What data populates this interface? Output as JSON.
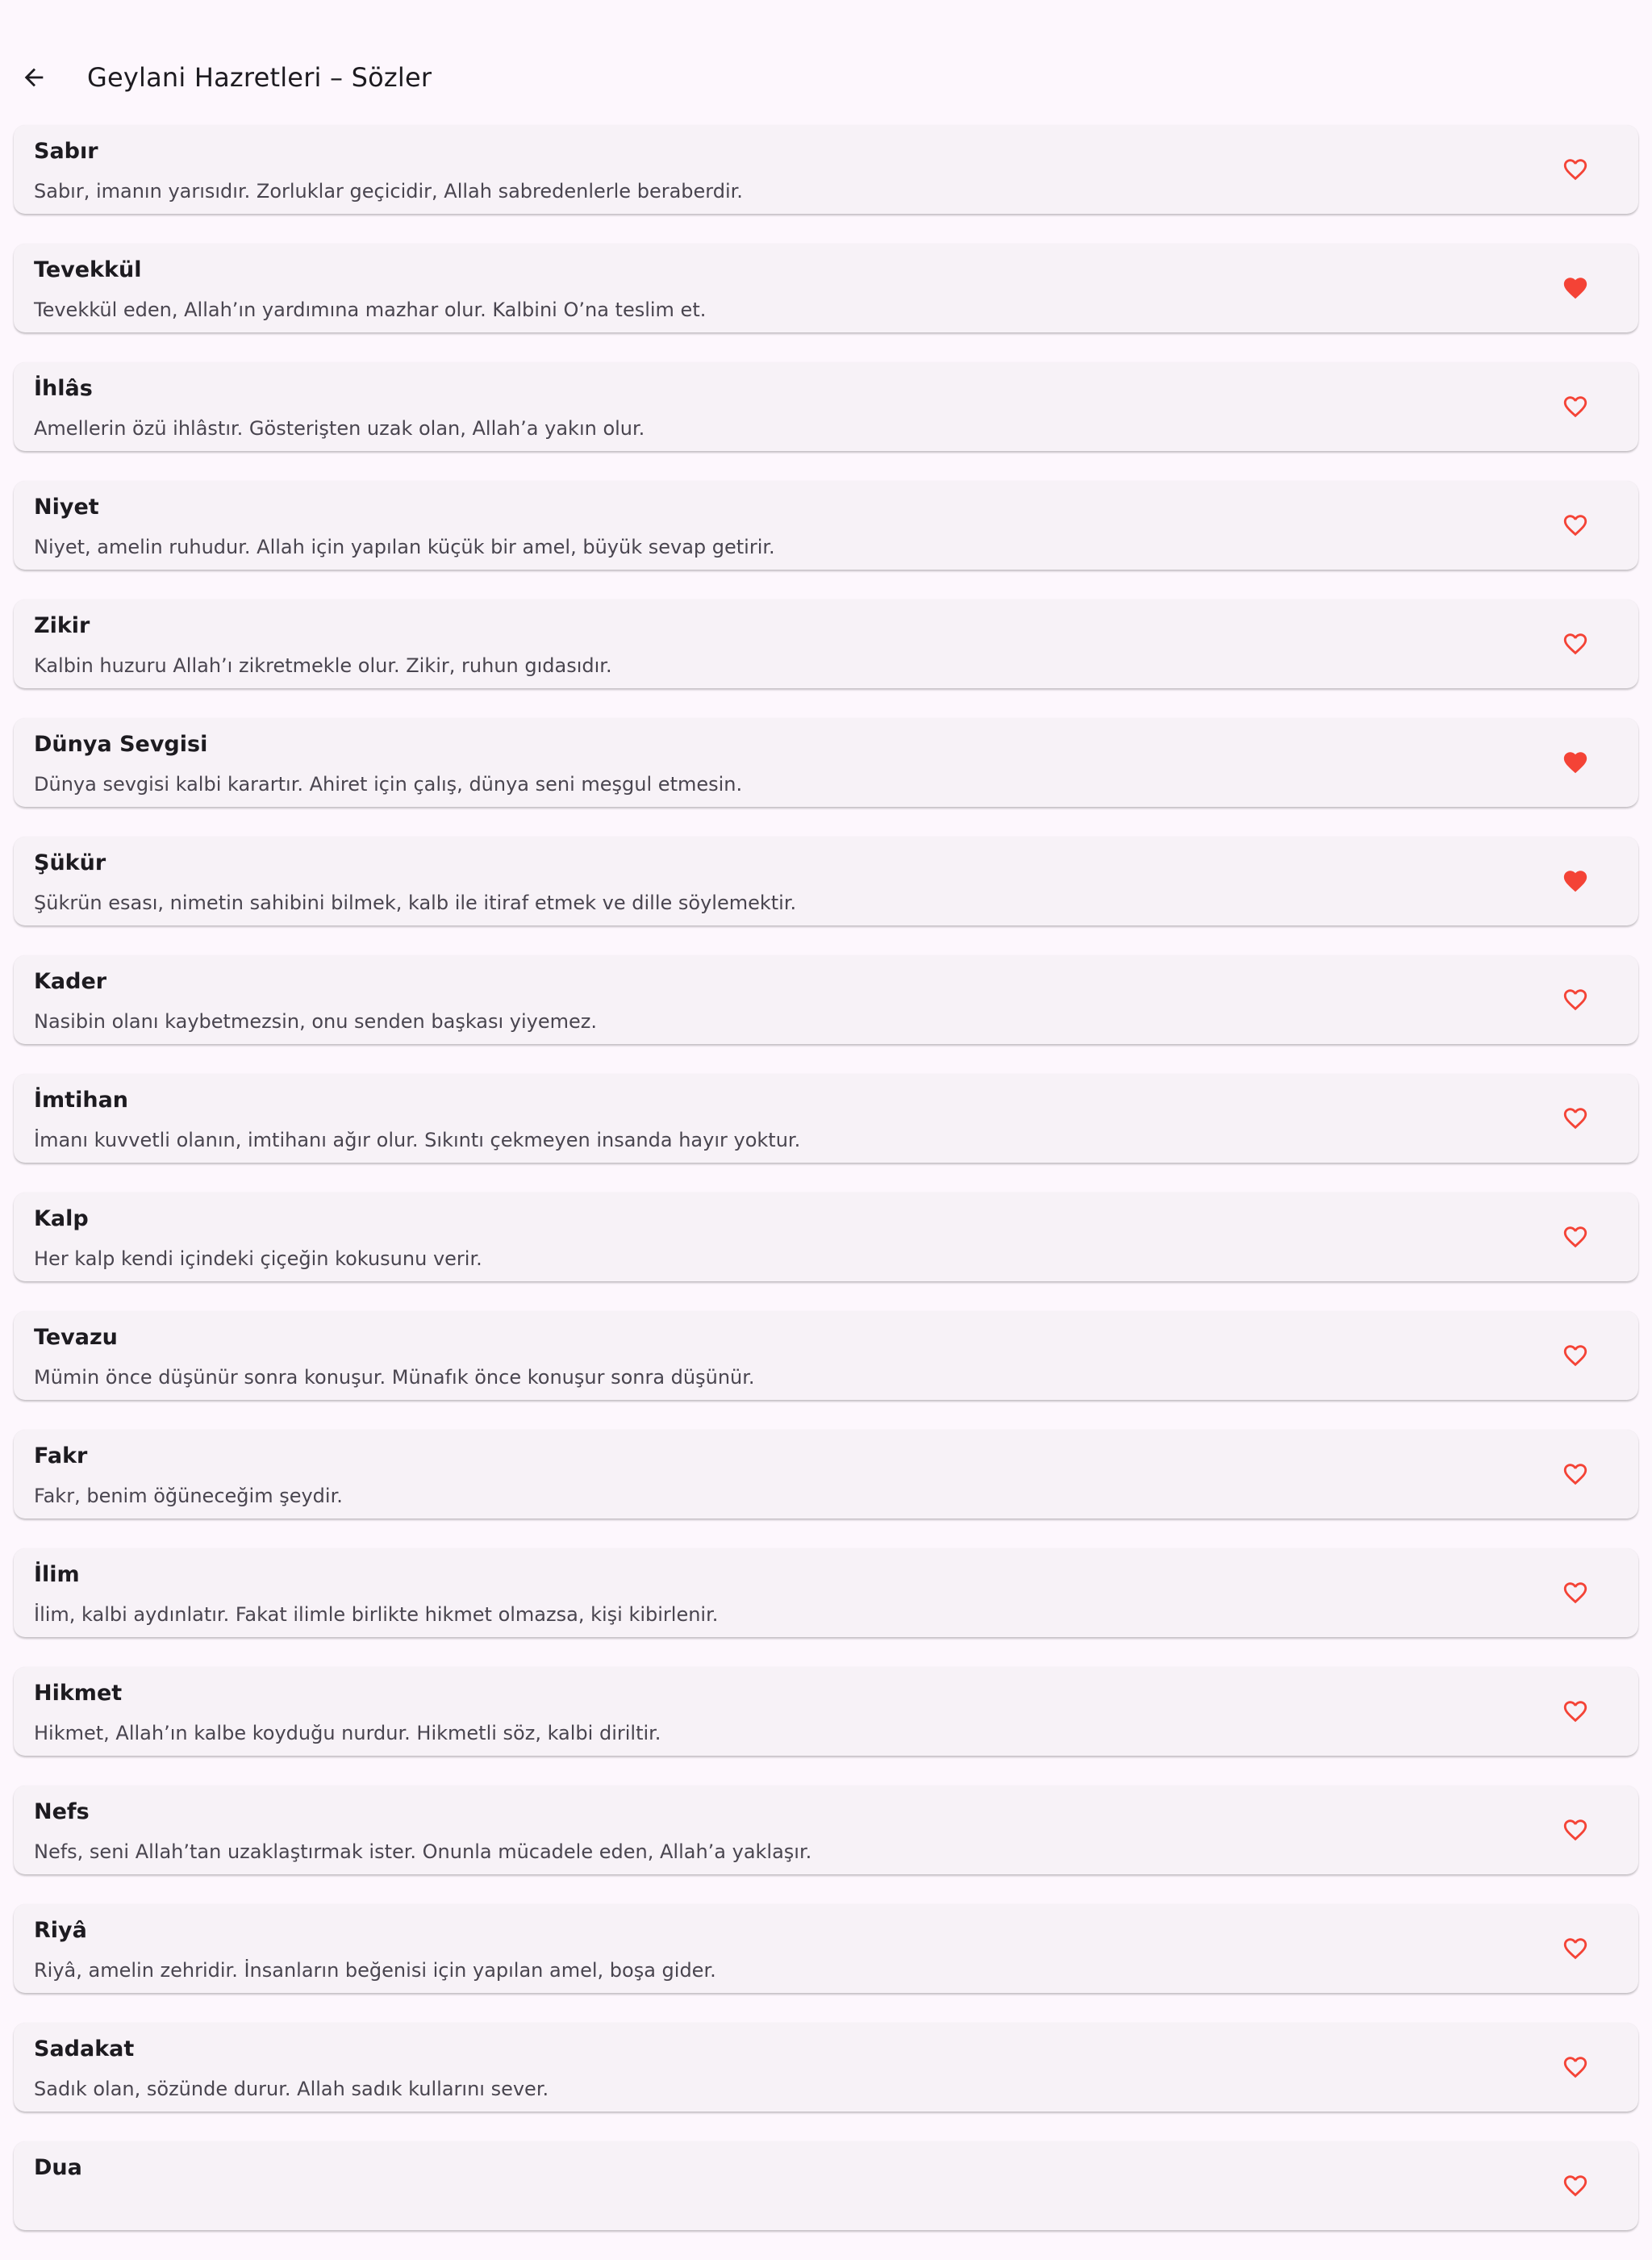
{
  "app_bar": {
    "title": "Geylani Hazretleri – Sözler"
  },
  "colors": {
    "background": "#FDF7FD",
    "card": "#F7F2F7",
    "heart": "#F44336"
  },
  "items": [
    {
      "title": "Sabır",
      "text": "Sabır, imanın yarısıdır. Zorluklar geçicidir, Allah sabredenlerle beraberdir.",
      "favorite": false
    },
    {
      "title": "Tevekkül",
      "text": "Tevekkül eden, Allah’ın yardımına mazhar olur. Kalbini O’na teslim et.",
      "favorite": true
    },
    {
      "title": "İhlâs",
      "text": "Amellerin özü ihlâstır. Gösterişten uzak olan, Allah’a yakın olur.",
      "favorite": false
    },
    {
      "title": "Niyet",
      "text": "Niyet, amelin ruhudur. Allah için yapılan küçük bir amel, büyük sevap getirir.",
      "favorite": false
    },
    {
      "title": "Zikir",
      "text": "Kalbin huzuru Allah’ı zikretmekle olur. Zikir, ruhun gıdasıdır.",
      "favorite": false
    },
    {
      "title": "Dünya Sevgisi",
      "text": "Dünya sevgisi kalbi karartır. Ahiret için çalış, dünya seni meşgul etmesin.",
      "favorite": true
    },
    {
      "title": "Şükür",
      "text": "Şükrün esası, nimetin sahibini bilmek, kalb ile itiraf etmek ve dille söylemektir.",
      "favorite": true
    },
    {
      "title": "Kader",
      "text": "Nasibin olanı kaybetmezsin, onu senden başkası yiyemez.",
      "favorite": false
    },
    {
      "title": "İmtihan",
      "text": "İmanı kuvvetli olanın, imtihanı ağır olur. Sıkıntı çekmeyen insanda hayır yoktur.",
      "favorite": false
    },
    {
      "title": "Kalp",
      "text": "Her kalp kendi içindeki çiçeğin kokusunu verir.",
      "favorite": false
    },
    {
      "title": "Tevazu",
      "text": "Mümin önce düşünür sonra konuşur. Münafık önce konuşur sonra düşünür.",
      "favorite": false
    },
    {
      "title": "Fakr",
      "text": "Fakr, benim öğüneceğim şeydir.",
      "favorite": false
    },
    {
      "title": "İlim",
      "text": "İlim, kalbi aydınlatır. Fakat ilimle birlikte hikmet olmazsa, kişi kibirlenir.",
      "favorite": false
    },
    {
      "title": "Hikmet",
      "text": "Hikmet, Allah’ın kalbe koyduğu nurdur. Hikmetli söz, kalbi diriltir.",
      "favorite": false
    },
    {
      "title": "Nefs",
      "text": "Nefs, seni Allah’tan uzaklaştırmak ister. Onunla mücadele eden, Allah’a yaklaşır.",
      "favorite": false
    },
    {
      "title": "Riyâ",
      "text": "Riyâ, amelin zehridir. İnsanların beğenisi için yapılan amel, boşa gider.",
      "favorite": false
    },
    {
      "title": "Sadakat",
      "text": "Sadık olan, sözünde durur. Allah sadık kullarını sever.",
      "favorite": false
    },
    {
      "title": "Dua",
      "text": "",
      "favorite": false
    }
  ]
}
